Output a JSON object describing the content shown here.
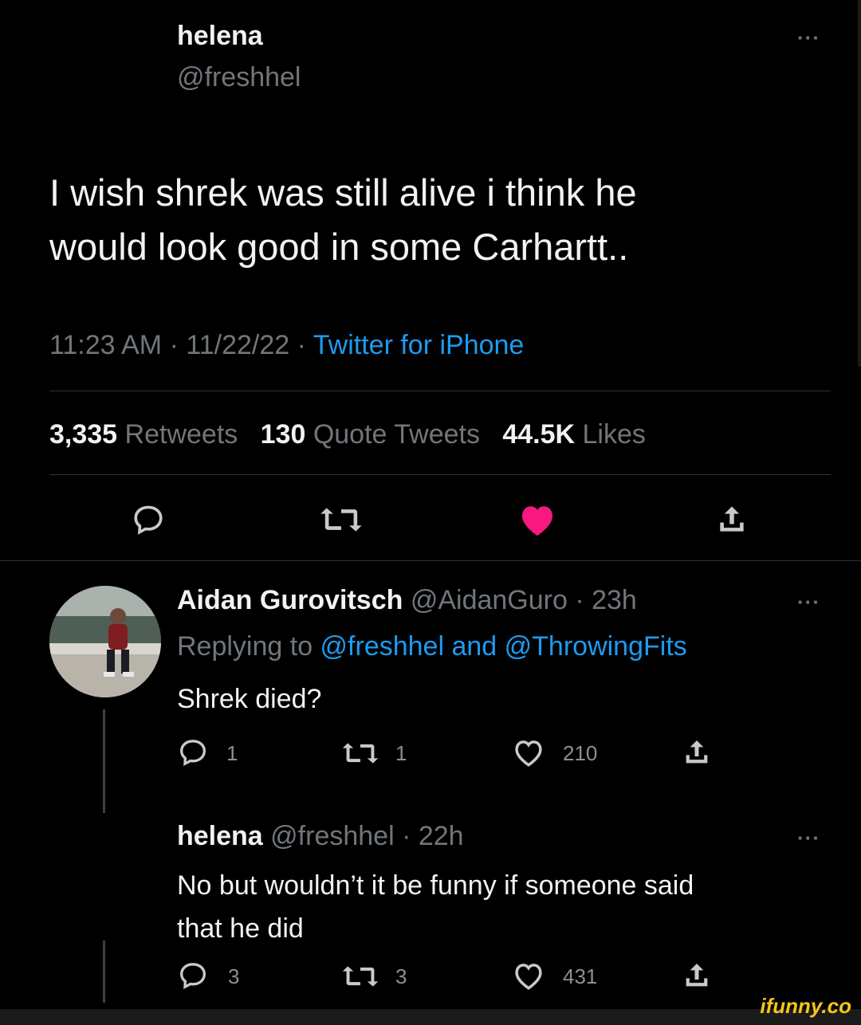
{
  "main_tweet": {
    "name": "helena",
    "handle": "@freshhel",
    "more": "···",
    "text_line1": "I wish shrek was still alive i think he",
    "text_line2": "would look good in some Carhartt..",
    "time_date": "11:23 AM · 11/22/22 · ",
    "source": "Twitter for iPhone",
    "stats": {
      "retweets_count": "3,335",
      "retweets_label": "Retweets",
      "quotes_count": "130",
      "quotes_label": "Quote Tweets",
      "likes_count": "44.5K",
      "likes_label": "Likes"
    },
    "actions": [
      "reply-icon",
      "retweet-icon",
      "like-icon-filled",
      "share-icon"
    ],
    "like_color": "#f91880"
  },
  "reply1": {
    "name": "Aidan Gurovitsch",
    "handle_time": " @AidanGuro · 23h",
    "more": "···",
    "replying_prefix": "Replying to ",
    "replying_targets": "@freshhel and @ThrowingFits",
    "text": "Shrek died?",
    "reply_count": "1",
    "retweet_count": "1",
    "like_count": "210"
  },
  "reply2": {
    "name": "helena",
    "handle_time": " @freshhel · 22h",
    "more": "···",
    "text_line1": "No but wouldn’t it be funny if someone said",
    "text_line2": "that  he did",
    "reply_count": "3",
    "retweet_count": "3",
    "like_count": "431"
  },
  "watermark": "ifunny.co",
  "colors": {
    "accent": "#1d9bf0",
    "like": "#f91880",
    "background": "#000000"
  }
}
